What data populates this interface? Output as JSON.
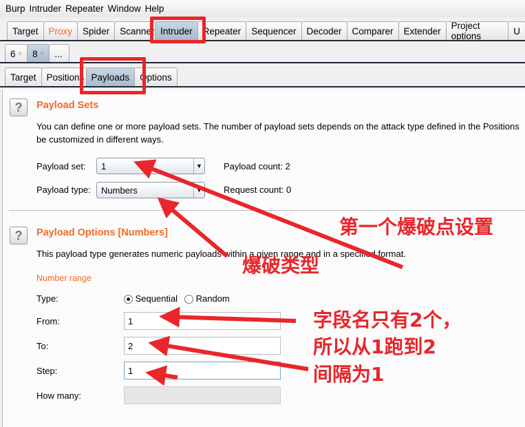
{
  "menu": [
    "Burp",
    "Intruder",
    "Repeater",
    "Window",
    "Help"
  ],
  "main_tabs": [
    "Target",
    "Proxy",
    "Spider",
    "Scanner",
    "Intruder",
    "Repeater",
    "Sequencer",
    "Decoder",
    "Comparer",
    "Extender",
    "Project options",
    "U"
  ],
  "sub_tabs": [
    {
      "label": "6",
      "close": "×"
    },
    {
      "label": "8",
      "close": "×"
    },
    {
      "label": "..."
    }
  ],
  "inner_tabs": [
    "Target",
    "Positions",
    "Payloads",
    "Options"
  ],
  "payload_sets": {
    "title": "Payload Sets",
    "help": "?",
    "desc1": "You can define one or more payload sets. The number of payload sets depends on the attack type defined in the Positions",
    "desc2": "be customized in different ways.",
    "set_label": "Payload set:",
    "set_value": "1",
    "type_label": "Payload type:",
    "type_value": "Numbers",
    "payload_count": "Payload count:  2",
    "request_count": "Request count:  0"
  },
  "payload_options": {
    "title": "Payload Options [Numbers]",
    "help": "?",
    "desc": "This payload type generates numeric payloads within a given range and in a specified format.",
    "section": "Number range",
    "type_label": "Type:",
    "sequential": "Sequential",
    "random": "Random",
    "from_label": "From:",
    "from_value": "1",
    "to_label": "To:",
    "to_value": "2",
    "step_label": "Step:",
    "step_value": "1",
    "howmany_label": "How many:",
    "howmany_value": ""
  },
  "annotations": {
    "first_point": "第一个爆破点设置",
    "attack_type": "爆破类型",
    "line1": "字段名只有2个，",
    "line2": "所以从1跑到2",
    "line3": "间隔为1"
  },
  "colors": {
    "accent": "#f26a2b",
    "annotation": "#e8262b"
  }
}
